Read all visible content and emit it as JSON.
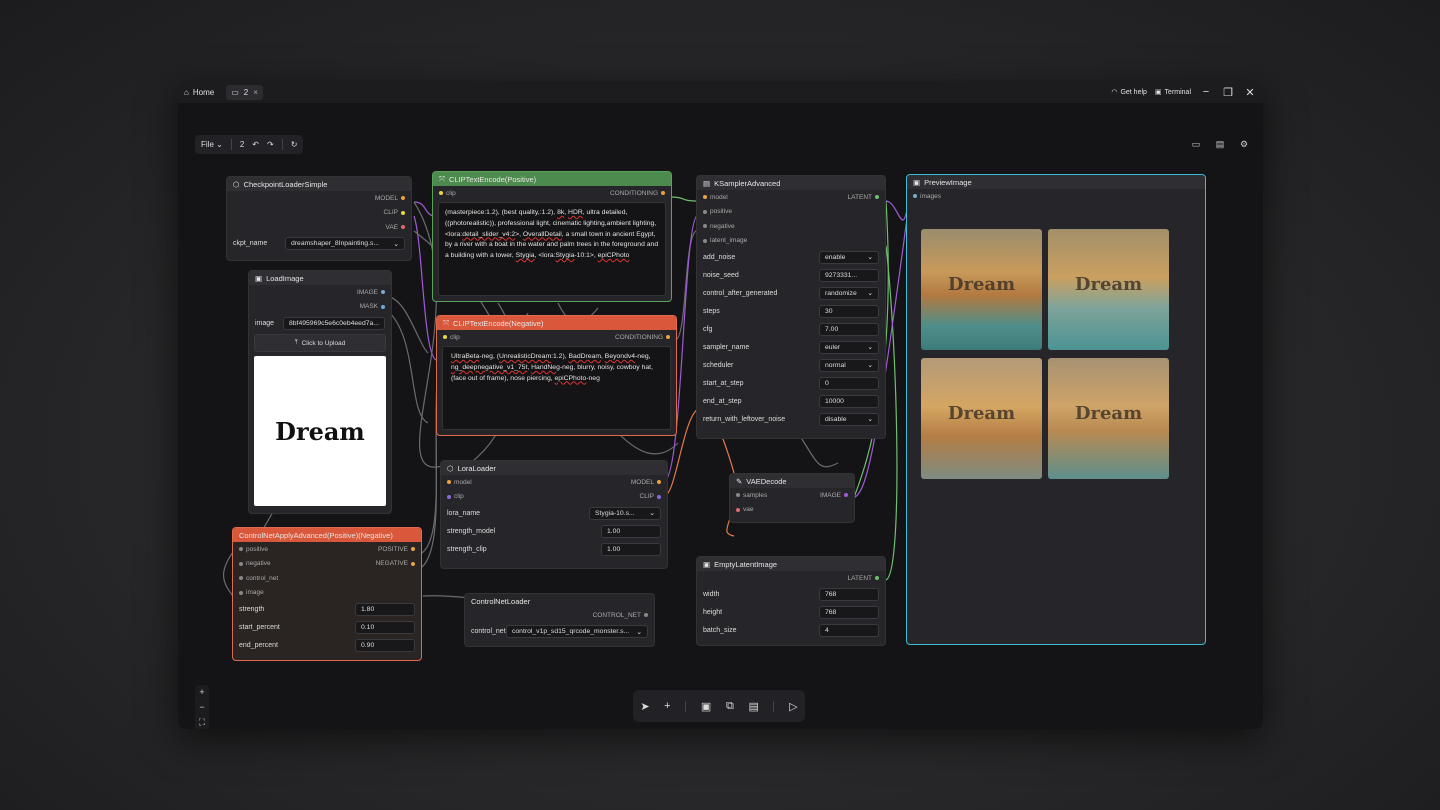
{
  "titlebar": {
    "home_label": "Home",
    "tab_label": "2",
    "tab_close": "×",
    "get_help": "Get help",
    "terminal": "Terminal"
  },
  "toolbar": {
    "file_label": "File",
    "workflow_name": "2"
  },
  "nodes": {
    "checkpoint": {
      "title": "CheckpointLoaderSimple",
      "outputs": [
        "MODEL",
        "CLIP",
        "VAE"
      ],
      "ckpt_label": "ckpt_name",
      "ckpt_value": "dreamshaper_8Inpainting.s..."
    },
    "loadimage": {
      "title": "LoadImage",
      "outputs": [
        "IMAGE",
        "MASK"
      ],
      "image_label": "image",
      "image_value": "8bf495969c5e6c0eb4eed7a...",
      "upload_label": "Click to Upload",
      "preview_text": "Dream"
    },
    "clip_pos": {
      "title": "CLIPTextEncode(Positive)",
      "input": "clip",
      "output": "CONDITIONING"
    },
    "clip_neg": {
      "title": "CLIPTextEncode(Negative)",
      "input": "clip",
      "output": "CONDITIONING"
    },
    "ksampler": {
      "title": "KSamplerAdvanced",
      "inputs": [
        "model",
        "positive",
        "negative",
        "latent_image"
      ],
      "output": "LATENT",
      "widgets": [
        {
          "label": "add_noise",
          "value": "enable"
        },
        {
          "label": "noise_seed",
          "value": "9273331..."
        },
        {
          "label": "control_after_generated",
          "value": "randomize"
        },
        {
          "label": "steps",
          "value": "30"
        },
        {
          "label": "cfg",
          "value": "7.00"
        },
        {
          "label": "sampler_name",
          "value": "euler"
        },
        {
          "label": "scheduler",
          "value": "normal"
        },
        {
          "label": "start_at_step",
          "value": "0"
        },
        {
          "label": "end_at_step",
          "value": "10000"
        },
        {
          "label": "return_with_leftover_noise",
          "value": "disable"
        }
      ]
    },
    "preview": {
      "title": "PreviewImage",
      "input": "images",
      "thumb_text": "Dream"
    },
    "lora": {
      "title": "LoraLoader",
      "inputs": [
        "model",
        "clip"
      ],
      "outputs": [
        "MODEL",
        "CLIP"
      ],
      "lora_label": "lora_name",
      "lora_value": "Stygia-10.s...",
      "strength_model_label": "strength_model",
      "strength_model_value": "1.00",
      "strength_clip_label": "strength_clip",
      "strength_clip_value": "1.00"
    },
    "vaedecode": {
      "title": "VAEDecode",
      "inputs": [
        "samples",
        "vae"
      ],
      "output": "IMAGE"
    },
    "empty_latent": {
      "title": "EmptyLatentImage",
      "output": "LATENT",
      "width_label": "width",
      "width_value": "768",
      "height_label": "height",
      "height_value": "768",
      "batch_label": "batch_size",
      "batch_value": "4"
    },
    "controlnet_apply": {
      "title": "ControlNetApplyAdvanced(Positive)(Negative)",
      "inputs": [
        "positive",
        "negative",
        "control_net",
        "image"
      ],
      "outputs": [
        "POSITIVE",
        "NEGATIVE"
      ],
      "strength_label": "strength",
      "strength_value": "1.80",
      "start_label": "start_percent",
      "start_value": "0.10",
      "end_label": "end_percent",
      "end_value": "0.90"
    },
    "controlnet_loader": {
      "title": "ControlNetLoader",
      "output": "CONTROL_NET",
      "control_label": "control_net",
      "control_value": "control_v1p_sd15_qrcode_monster.s..."
    }
  },
  "colors": {
    "green_node": "#4d8a4d",
    "red_node": "#d9573b",
    "cyan_border": "#3dbcd6",
    "link_purple": "#a15ad6",
    "link_green": "#6fbf6f",
    "link_orange": "#e07a4a",
    "link_grey": "#6a6a70"
  }
}
